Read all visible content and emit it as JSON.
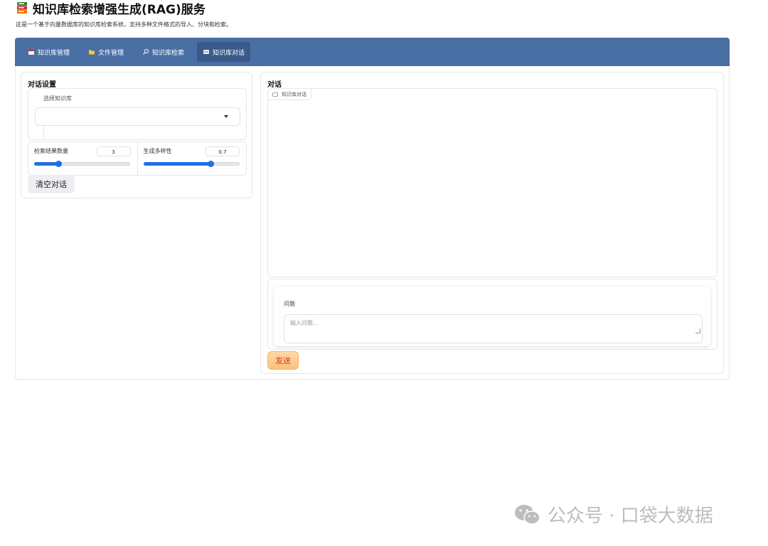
{
  "header": {
    "title": "知识库检索增强生成(RAG)服务",
    "description": "这是一个基于向量数据库的知识库检索系统，支持多种文件格式的导入、分块和检索。",
    "title_icon": "books-icon"
  },
  "tabs": [
    {
      "label": "知识库管理",
      "icon": "database-icon",
      "active": false
    },
    {
      "label": "文件管理",
      "icon": "folder-icon",
      "active": false
    },
    {
      "label": "知识库检索",
      "icon": "search-icon",
      "active": false
    },
    {
      "label": "知识库对话",
      "icon": "chat-icon",
      "active": true
    }
  ],
  "settings": {
    "title": "对话设置",
    "kb_label": "选择知识库",
    "kb_value": "",
    "top_k": {
      "label": "检索结果数量",
      "value": "3",
      "fraction": 0.25
    },
    "temperature": {
      "label": "生成多样性",
      "value": "0.7",
      "fraction": 0.7
    },
    "clear_label": "清空对话"
  },
  "chat": {
    "title": "对话",
    "chatbot_label": "知识库对话",
    "question_label": "问题",
    "question_placeholder": "输入问题...",
    "send_label": "发送"
  },
  "watermark": {
    "text": "公众号 · 口袋大数据"
  },
  "colors": {
    "tab_bar": "#4a6fa5",
    "accent": "#1f6fe5",
    "send": "#fbc07d"
  }
}
